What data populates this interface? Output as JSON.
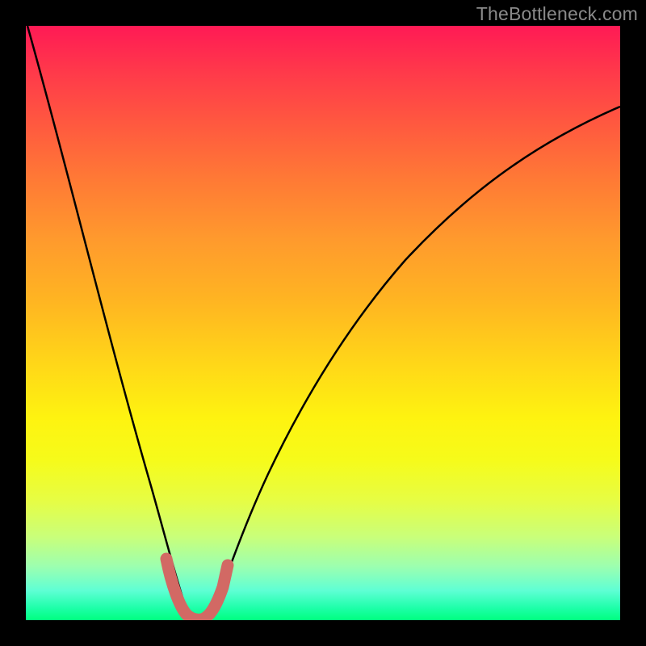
{
  "watermark": "TheBottleneck.com",
  "chart_data": {
    "type": "line",
    "title": "",
    "xlabel": "",
    "ylabel": "",
    "xlim": [
      0,
      1
    ],
    "ylim": [
      0,
      1
    ],
    "series": [
      {
        "name": "bottleneck-curve",
        "x": [
          0.0,
          0.03,
          0.06,
          0.09,
          0.12,
          0.15,
          0.18,
          0.2,
          0.22,
          0.24,
          0.26,
          0.28,
          0.3,
          0.32,
          0.34,
          0.36,
          0.4,
          0.45,
          0.5,
          0.55,
          0.6,
          0.65,
          0.7,
          0.75,
          0.8,
          0.85,
          0.9,
          0.95,
          1.0
        ],
        "y": [
          1.0,
          0.88,
          0.76,
          0.64,
          0.52,
          0.4,
          0.28,
          0.19,
          0.11,
          0.05,
          0.01,
          0.0,
          0.01,
          0.05,
          0.11,
          0.18,
          0.29,
          0.4,
          0.49,
          0.56,
          0.62,
          0.67,
          0.71,
          0.745,
          0.775,
          0.8,
          0.82,
          0.838,
          0.855
        ]
      },
      {
        "name": "highlight-band",
        "x": [
          0.225,
          0.25,
          0.275,
          0.3,
          0.325
        ],
        "y": [
          0.095,
          0.03,
          0.0,
          0.03,
          0.095
        ]
      }
    ],
    "annotations": []
  },
  "colors": {
    "curve": "#000000",
    "highlight": "#d26964",
    "frame": "#000000"
  }
}
